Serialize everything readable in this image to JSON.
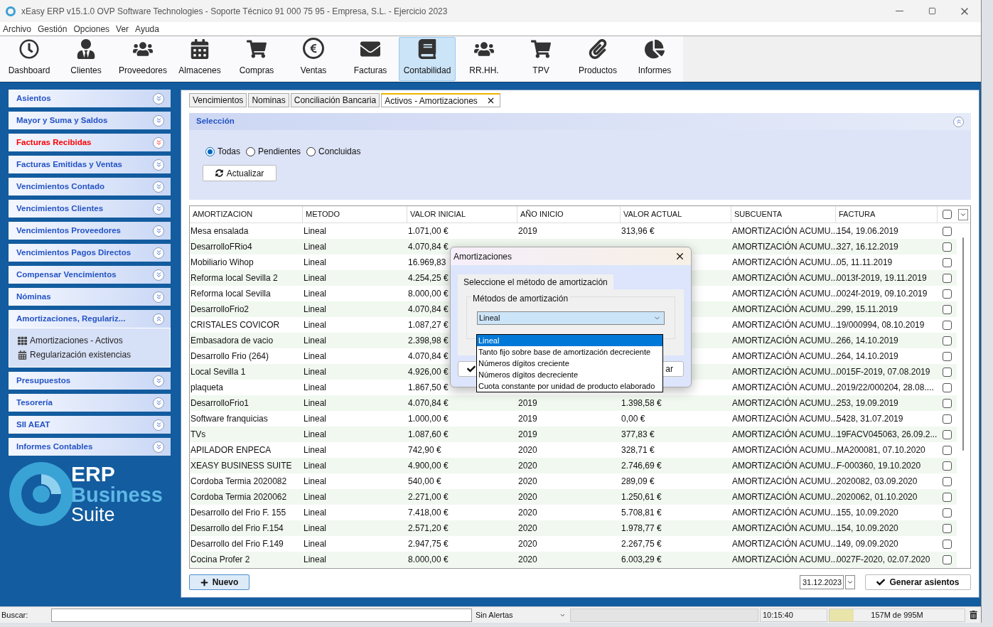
{
  "window": {
    "title": "xEasy ERP v15.1.0 OVP Software Technologies - Soporte Técnico 91 000 75 95 - Empresa, S.L. - Ejercicio 2023"
  },
  "menu": [
    "Archivo",
    "Gestión",
    "Opciones",
    "Ver",
    "Ayuda"
  ],
  "toolbar": [
    {
      "label": "Dashboard",
      "selected": false
    },
    {
      "label": "Clientes",
      "selected": false
    },
    {
      "label": "Proveedores",
      "selected": false
    },
    {
      "label": "Almacenes",
      "selected": false
    },
    {
      "label": "Compras",
      "selected": false
    },
    {
      "label": "Ventas",
      "selected": false
    },
    {
      "label": "Facturas",
      "selected": false
    },
    {
      "label": "Contabilidad",
      "selected": true
    },
    {
      "label": "RR.HH.",
      "selected": false
    },
    {
      "label": "TPV",
      "selected": false
    },
    {
      "label": "Productos",
      "selected": false
    },
    {
      "label": "Informes",
      "selected": false
    }
  ],
  "sidebar": {
    "items": [
      {
        "label": "Asientos",
        "highlighted": false,
        "expanded": false
      },
      {
        "label": "Mayor y Suma y Saldos",
        "highlighted": false,
        "expanded": false
      },
      {
        "label": "Facturas Recibidas",
        "highlighted": true,
        "expanded": false
      },
      {
        "label": "Facturas Emitidas y Ventas",
        "highlighted": false,
        "expanded": false
      },
      {
        "label": "Vencimientos Contado",
        "highlighted": false,
        "expanded": false
      },
      {
        "label": "Vencimientos Clientes",
        "highlighted": false,
        "expanded": false
      },
      {
        "label": "Vencimientos Proveedores",
        "highlighted": false,
        "expanded": false
      },
      {
        "label": "Vencimientos Pagos Directos",
        "highlighted": false,
        "expanded": false
      },
      {
        "label": "Compensar Vencimientos",
        "highlighted": false,
        "expanded": false
      },
      {
        "label": "Nóminas",
        "highlighted": false,
        "expanded": false
      },
      {
        "label": "Amortizaciones, Regulariz...",
        "highlighted": false,
        "expanded": true,
        "children": [
          {
            "label": "Amortizaciones - Activos",
            "kind": "grid"
          },
          {
            "label": "Regularización existencias",
            "kind": "calendar"
          }
        ]
      },
      {
        "label": "Presupuestos",
        "highlighted": false,
        "expanded": false
      },
      {
        "label": "Tesorería",
        "highlighted": false,
        "expanded": false
      },
      {
        "label": "SII AEAT",
        "highlighted": false,
        "expanded": false
      },
      {
        "label": "Informes Contables",
        "highlighted": false,
        "expanded": false
      }
    ],
    "logo": {
      "line1": "ERP",
      "line2": "Business",
      "line3": "Suite"
    }
  },
  "tabs": [
    {
      "label": "Vencimientos",
      "selected": false,
      "closable": false
    },
    {
      "label": "Nominas",
      "selected": false,
      "closable": false
    },
    {
      "label": "Conciliación Bancaria",
      "selected": false,
      "closable": false
    },
    {
      "label": "Activos - Amortizaciones",
      "selected": true,
      "closable": true
    }
  ],
  "seleccion": {
    "title": "Selección",
    "expanded": true,
    "filters": [
      {
        "label": "Todas",
        "selected": true
      },
      {
        "label": "Pendientes",
        "selected": false
      },
      {
        "label": "Concluidas",
        "selected": false
      }
    ],
    "refresh_button": "Actualizar"
  },
  "table": {
    "columns": [
      "AMORTIZACION",
      "METODO",
      "VALOR INICIAL",
      "AÑO INICIO",
      "VALOR ACTUAL",
      "SUBCUENTA",
      "FACTURA"
    ],
    "all_checked": false,
    "rows": [
      {
        "cells": [
          "Mesa ensalada",
          "Lineal",
          "1.071,00 €",
          "2019",
          "313,96 €",
          "AMORTIZACIÓN ACUMU...",
          "154, 19.06.2019"
        ],
        "checked": false
      },
      {
        "cells": [
          "DesarrolloFRio4",
          "Lineal",
          "4.070,84 €",
          null,
          null,
          "AMORTIZACIÓN ACUMU...",
          "327, 16.12.2019"
        ],
        "checked": false
      },
      {
        "cells": [
          "Mobiliario Wihop",
          "Lineal",
          "16.969,83",
          null,
          null,
          "AMORTIZACIÓN ACUMU...",
          "05, 11.11.2019"
        ],
        "checked": false
      },
      {
        "cells": [
          "Reforma local Sevilla 2",
          "Lineal",
          "4.254,25 €",
          null,
          null,
          "AMORTIZACIÓN ACUMU...",
          "0013f-2019, 19.11.2019"
        ],
        "checked": false
      },
      {
        "cells": [
          "Reforma local Sevilla",
          "Lineal",
          "8.000,00 €",
          null,
          null,
          "AMORTIZACIÓN ACUMU...",
          "0024f-2019, 09.10.2019"
        ],
        "checked": false
      },
      {
        "cells": [
          "DesarrolloFrio2",
          "Lineal",
          "4.070,84 €",
          null,
          null,
          "AMORTIZACIÓN ACUMU...",
          "299, 15.11.2019"
        ],
        "checked": false
      },
      {
        "cells": [
          "CRISTALES COVICOR",
          "Lineal",
          "1.087,27 €",
          null,
          null,
          "AMORTIZACIÓN ACUMU...",
          "19/000994, 08.10.2019"
        ],
        "checked": false
      },
      {
        "cells": [
          "Embasadora de vacio",
          "Lineal",
          "2.398,98 €",
          null,
          null,
          "AMORTIZACIÓN ACUMU...",
          "266, 14.10.2019"
        ],
        "checked": false
      },
      {
        "cells": [
          "Desarrollo Frio (264)",
          "Lineal",
          "4.070,84 €",
          null,
          null,
          "AMORTIZACIÓN ACUMU...",
          "264, 14.10.2019"
        ],
        "checked": false
      },
      {
        "cells": [
          "Local Sevilla 1",
          "Lineal",
          "4.926,00 €",
          null,
          null,
          "AMORTIZACIÓN ACUMU...",
          "0015F-2019, 07.08.2019"
        ],
        "checked": false
      },
      {
        "cells": [
          "plaqueta",
          "Lineal",
          "1.867,50 €",
          null,
          null,
          "AMORTIZACIÓN ACUMU...",
          "2019/22/000204, 28.08...."
        ],
        "checked": false
      },
      {
        "cells": [
          "DesarrolloFrio1",
          "Lineal",
          "4.070,84 €",
          "2019",
          "1.398,58 €",
          "AMORTIZACIÓN ACUMU...",
          "253, 19.09.2019"
        ],
        "checked": false
      },
      {
        "cells": [
          "Software franquicias",
          "Lineal",
          "1.000,00 €",
          "2019",
          "0,00 €",
          "AMORTIZACIÓN ACUMU...",
          "5428, 31.07.2019"
        ],
        "checked": false
      },
      {
        "cells": [
          "TVs",
          "Lineal",
          "1.087,60 €",
          "2019",
          "377,83 €",
          "AMORTIZACIÓN ACUMU...",
          "19FACV045063, 26.09.2..."
        ],
        "checked": false
      },
      {
        "cells": [
          "APILADOR ENPECA",
          "Lineal",
          "742,90 €",
          "2020",
          "328,71 €",
          "AMORTIZACIÓN ACUMU...",
          "MA200081, 07.10.2020"
        ],
        "checked": false
      },
      {
        "cells": [
          "XEASY BUSINESS SUITE",
          "Lineal",
          "4.900,00 €",
          "2020",
          "2.746,69 €",
          "AMORTIZACIÓN ACUMU...",
          "F-000360, 19.10.2020"
        ],
        "checked": false
      },
      {
        "cells": [
          "Cordoba Termia 2020082",
          "Lineal",
          "540,00 €",
          "2020",
          "289,09 €",
          "AMORTIZACIÓN ACUMU...",
          "2020082, 03.09.2020"
        ],
        "checked": false
      },
      {
        "cells": [
          "Cordoba Termia 2020062",
          "Lineal",
          "2.271,00 €",
          "2020",
          "1.250,61 €",
          "AMORTIZACIÓN ACUMU...",
          "2020062, 01.10.2020"
        ],
        "checked": false
      },
      {
        "cells": [
          "Desarrollo del Frio F. 155",
          "Lineal",
          "7.418,00 €",
          "2020",
          "5.708,81 €",
          "AMORTIZACIÓN ACUMU...",
          "155, 10.09.2020"
        ],
        "checked": false
      },
      {
        "cells": [
          "Desarrollo del Frio F.154",
          "Lineal",
          "2.571,20 €",
          "2020",
          "1.978,77 €",
          "AMORTIZACIÓN ACUMU...",
          "154, 10.09.2020"
        ],
        "checked": false
      },
      {
        "cells": [
          "Desarrollo del Frio F.149",
          "Lineal",
          "2.947,75 €",
          "2020",
          "2.267,75 €",
          "AMORTIZACIÓN ACUMU...",
          "149, 09.09.2020"
        ],
        "checked": false
      },
      {
        "cells": [
          "Cocina Profer 2",
          "Lineal",
          "8.000,00 €",
          "2020",
          "6.003,29 €",
          "AMORTIZACIÓN ACUMU...",
          "0027F-2020, 02.07.2020"
        ],
        "checked": false
      }
    ]
  },
  "footer": {
    "new_button": "Nuevo",
    "date": "31.12.2023",
    "generate_button": "Generar asientos"
  },
  "dialog": {
    "title": "Amortizaciones",
    "tab": "Seleccione el método de amortización",
    "group": "Métodos de amortización",
    "value": "Lineal",
    "options": [
      {
        "label": "Lineal",
        "selected": true
      },
      {
        "label": "Tanto fijo sobre base de amortización decreciente",
        "selected": false
      },
      {
        "label": "Números dígitos creciente",
        "selected": false
      },
      {
        "label": "Números dígitos decreciente",
        "selected": false
      },
      {
        "label": "Cuota constante por unidad de producto elaborado",
        "selected": false
      }
    ],
    "cancel_fragment": "ar"
  },
  "status_bar": {
    "search_label": "Buscar:",
    "alerts": "Sin Alertas",
    "time": "10:15:40",
    "memory": {
      "level": 0.18,
      "reading": "157M de 995M"
    }
  }
}
